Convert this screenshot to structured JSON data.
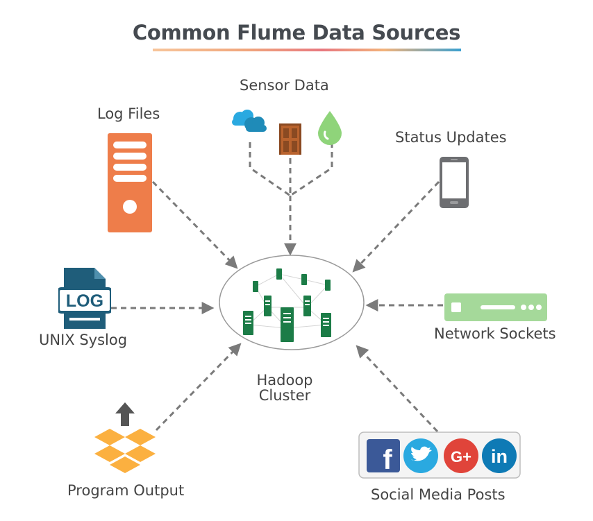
{
  "title": "Common Flume Data Sources",
  "center": {
    "line1": "Hadoop",
    "line2": "Cluster"
  },
  "sources": {
    "log_files": "Log Files",
    "sensor_data": "Sensor Data",
    "status_updates": "Status Updates",
    "unix_syslog": "UNIX Syslog",
    "network_sockets": "Network Sockets",
    "program_output": "Program Output",
    "social_media": "Social Media Posts"
  },
  "log_badge": "LOG",
  "social_badges": {
    "facebook": "f",
    "googleplus": "G+",
    "linkedin": "in"
  },
  "colors": {
    "title": "#454a50",
    "server_orange": "#ee7d4a",
    "log_blue": "#1f5d7a",
    "network_green": "#a5d99a",
    "dropbox_orange": "#fbb040",
    "cluster_green": "#1c7c47",
    "facebook": "#3b5998",
    "twitter": "#2aa9e0",
    "googleplus": "#e0443a",
    "linkedin": "#0e7ab5",
    "arrow": "#7a7a7a"
  }
}
